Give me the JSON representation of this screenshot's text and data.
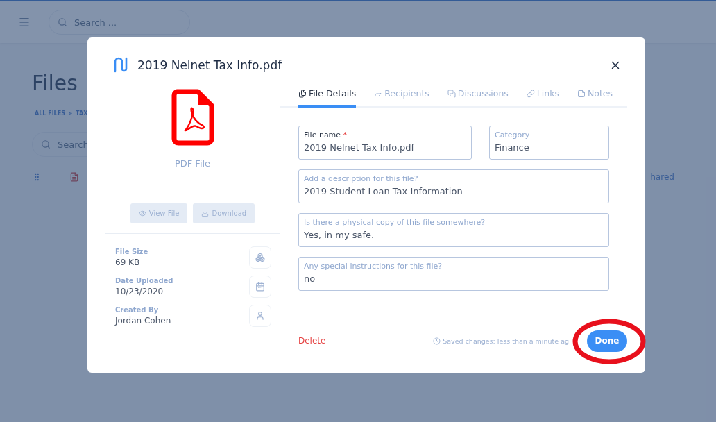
{
  "background": {
    "search": {
      "placeholder": "Search ..."
    },
    "page_title": "Files",
    "breadcrumb": [
      {
        "label": "ALL FILES"
      },
      {
        "label": "TAX"
      }
    ],
    "breadcrumb_separator": "»",
    "filter_search": {
      "placeholder": "Search"
    },
    "column_header": "hared"
  },
  "dialog": {
    "title": "2019 Nelnet Tax Info.pdf",
    "file_type": "PDF File",
    "actions": [
      {
        "kind": "view",
        "label": "View File"
      },
      {
        "kind": "download",
        "label": "Download"
      }
    ],
    "info": [
      {
        "kind": "size",
        "label": "File Size",
        "value": "69 KB"
      },
      {
        "kind": "date",
        "label": "Date Uploaded",
        "value": "10/23/2020"
      },
      {
        "kind": "user",
        "label": "Created By",
        "value": "Jordan Cohen"
      }
    ],
    "tabs": [
      {
        "kind": "details",
        "label": "File Details",
        "selected": true
      },
      {
        "kind": "recipients",
        "label": "Recipients",
        "selected": false
      },
      {
        "kind": "discussions",
        "label": "Discussions",
        "selected": false
      },
      {
        "kind": "links",
        "label": "Links",
        "selected": false
      },
      {
        "kind": "notes",
        "label": "Notes",
        "selected": false
      }
    ],
    "fields": [
      {
        "label": "File name",
        "required": true,
        "value": "2019 Nelnet Tax Info.pdf"
      },
      {
        "label": "Category",
        "required": false,
        "value": "Finance"
      },
      {
        "label": "Add a description for this file?",
        "required": false,
        "value": "2019 Student Loan Tax Information"
      },
      {
        "label": "Is there a physical copy of this file somewhere?",
        "required": false,
        "value": "Yes, in my safe."
      },
      {
        "label": "Any special instructions for this file?",
        "required": false,
        "value": "no"
      }
    ],
    "required_mark": "*",
    "delete_label": "Delete",
    "saved_status": "Saved changes: less than a minute ag",
    "done_label": "Done",
    "done_highlighted": true
  }
}
